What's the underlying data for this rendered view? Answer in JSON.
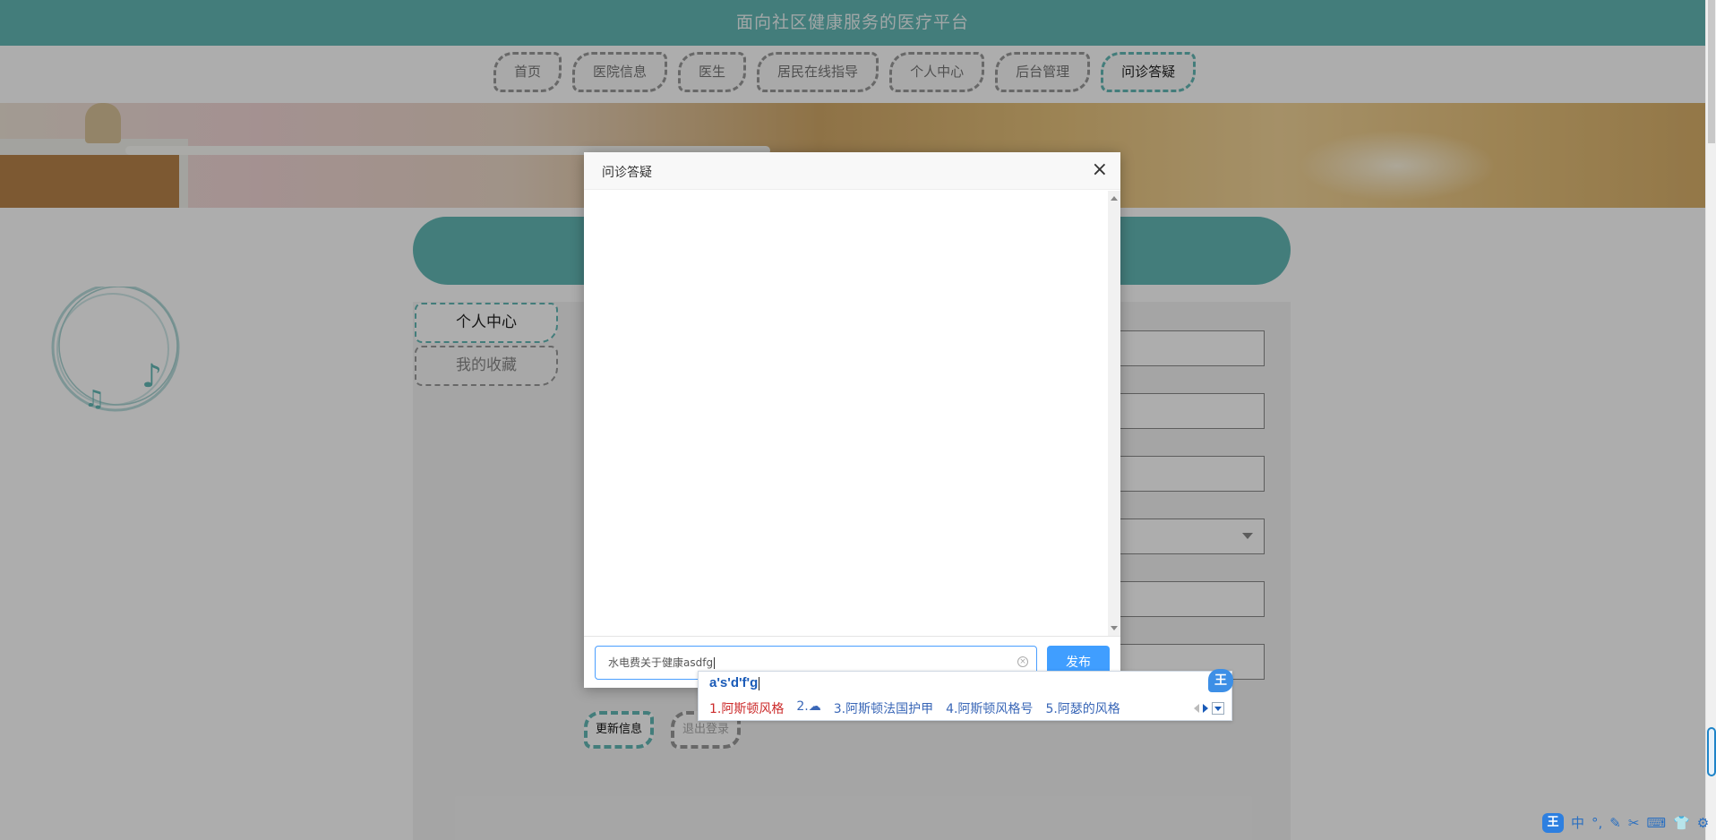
{
  "header": {
    "title": "面向社区健康服务的医疗平台"
  },
  "nav": {
    "items": [
      {
        "label": "首页"
      },
      {
        "label": "医院信息"
      },
      {
        "label": "医生"
      },
      {
        "label": "居民在线指导"
      },
      {
        "label": "个人中心"
      },
      {
        "label": "后台管理"
      },
      {
        "label": "问诊答疑",
        "active": true
      }
    ]
  },
  "sidebar": {
    "tabs": [
      {
        "label": "个人中心"
      },
      {
        "label": "我的收藏"
      }
    ]
  },
  "form": {
    "update_label": "更新信息",
    "logout_label": "退出登录"
  },
  "modal": {
    "title": "问诊答疑",
    "close_glyph": "×",
    "input_value": "水电费关于健康asdfg",
    "send_label": "发布"
  },
  "ime": {
    "composition": "a's'd'f'g",
    "logo": "王",
    "candidates": [
      "1.阿斯顿风格",
      "2.☁",
      "3.阿斯顿法国护甲",
      "4.阿斯顿风格号",
      "5.阿瑟的风格"
    ]
  },
  "tray": {
    "brand": "王",
    "mode": "中",
    "punct": "°,",
    "pen_icon": "✎",
    "scissors_icon": "✂",
    "keyboard_icon": "⌨",
    "shirt_icon": "👕",
    "gear_icon": "⚙"
  },
  "colors": {
    "accent": "#64b8b6",
    "primary_button": "#409eff"
  }
}
